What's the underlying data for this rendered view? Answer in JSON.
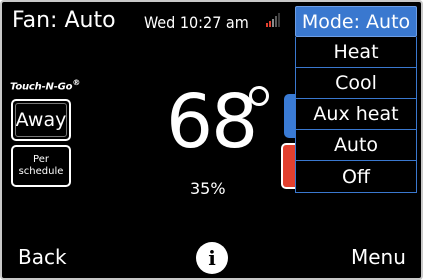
{
  "status_bar": {
    "fan": "Fan: Auto",
    "datetime": "Wed 10:27 am",
    "signal_icon": "signal-strength-icon"
  },
  "logo": {
    "text": "Touch-N-Go",
    "mark": "®"
  },
  "left_buttons": {
    "away": "Away",
    "schedule_line1": "Per",
    "schedule_line2": "schedule"
  },
  "main": {
    "temperature": "68",
    "humidity": "35%"
  },
  "mode_menu": {
    "header": "Mode: Auto",
    "options": [
      "Heat",
      "Cool",
      "Aux heat",
      "Auto",
      "Off"
    ]
  },
  "bottom_bar": {
    "back": "Back",
    "info": "i",
    "menu": "Menu"
  },
  "colors": {
    "background": "#000000",
    "accent_blue": "#3a78cf",
    "accent_red": "#e2402f",
    "text": "#ffffff"
  }
}
